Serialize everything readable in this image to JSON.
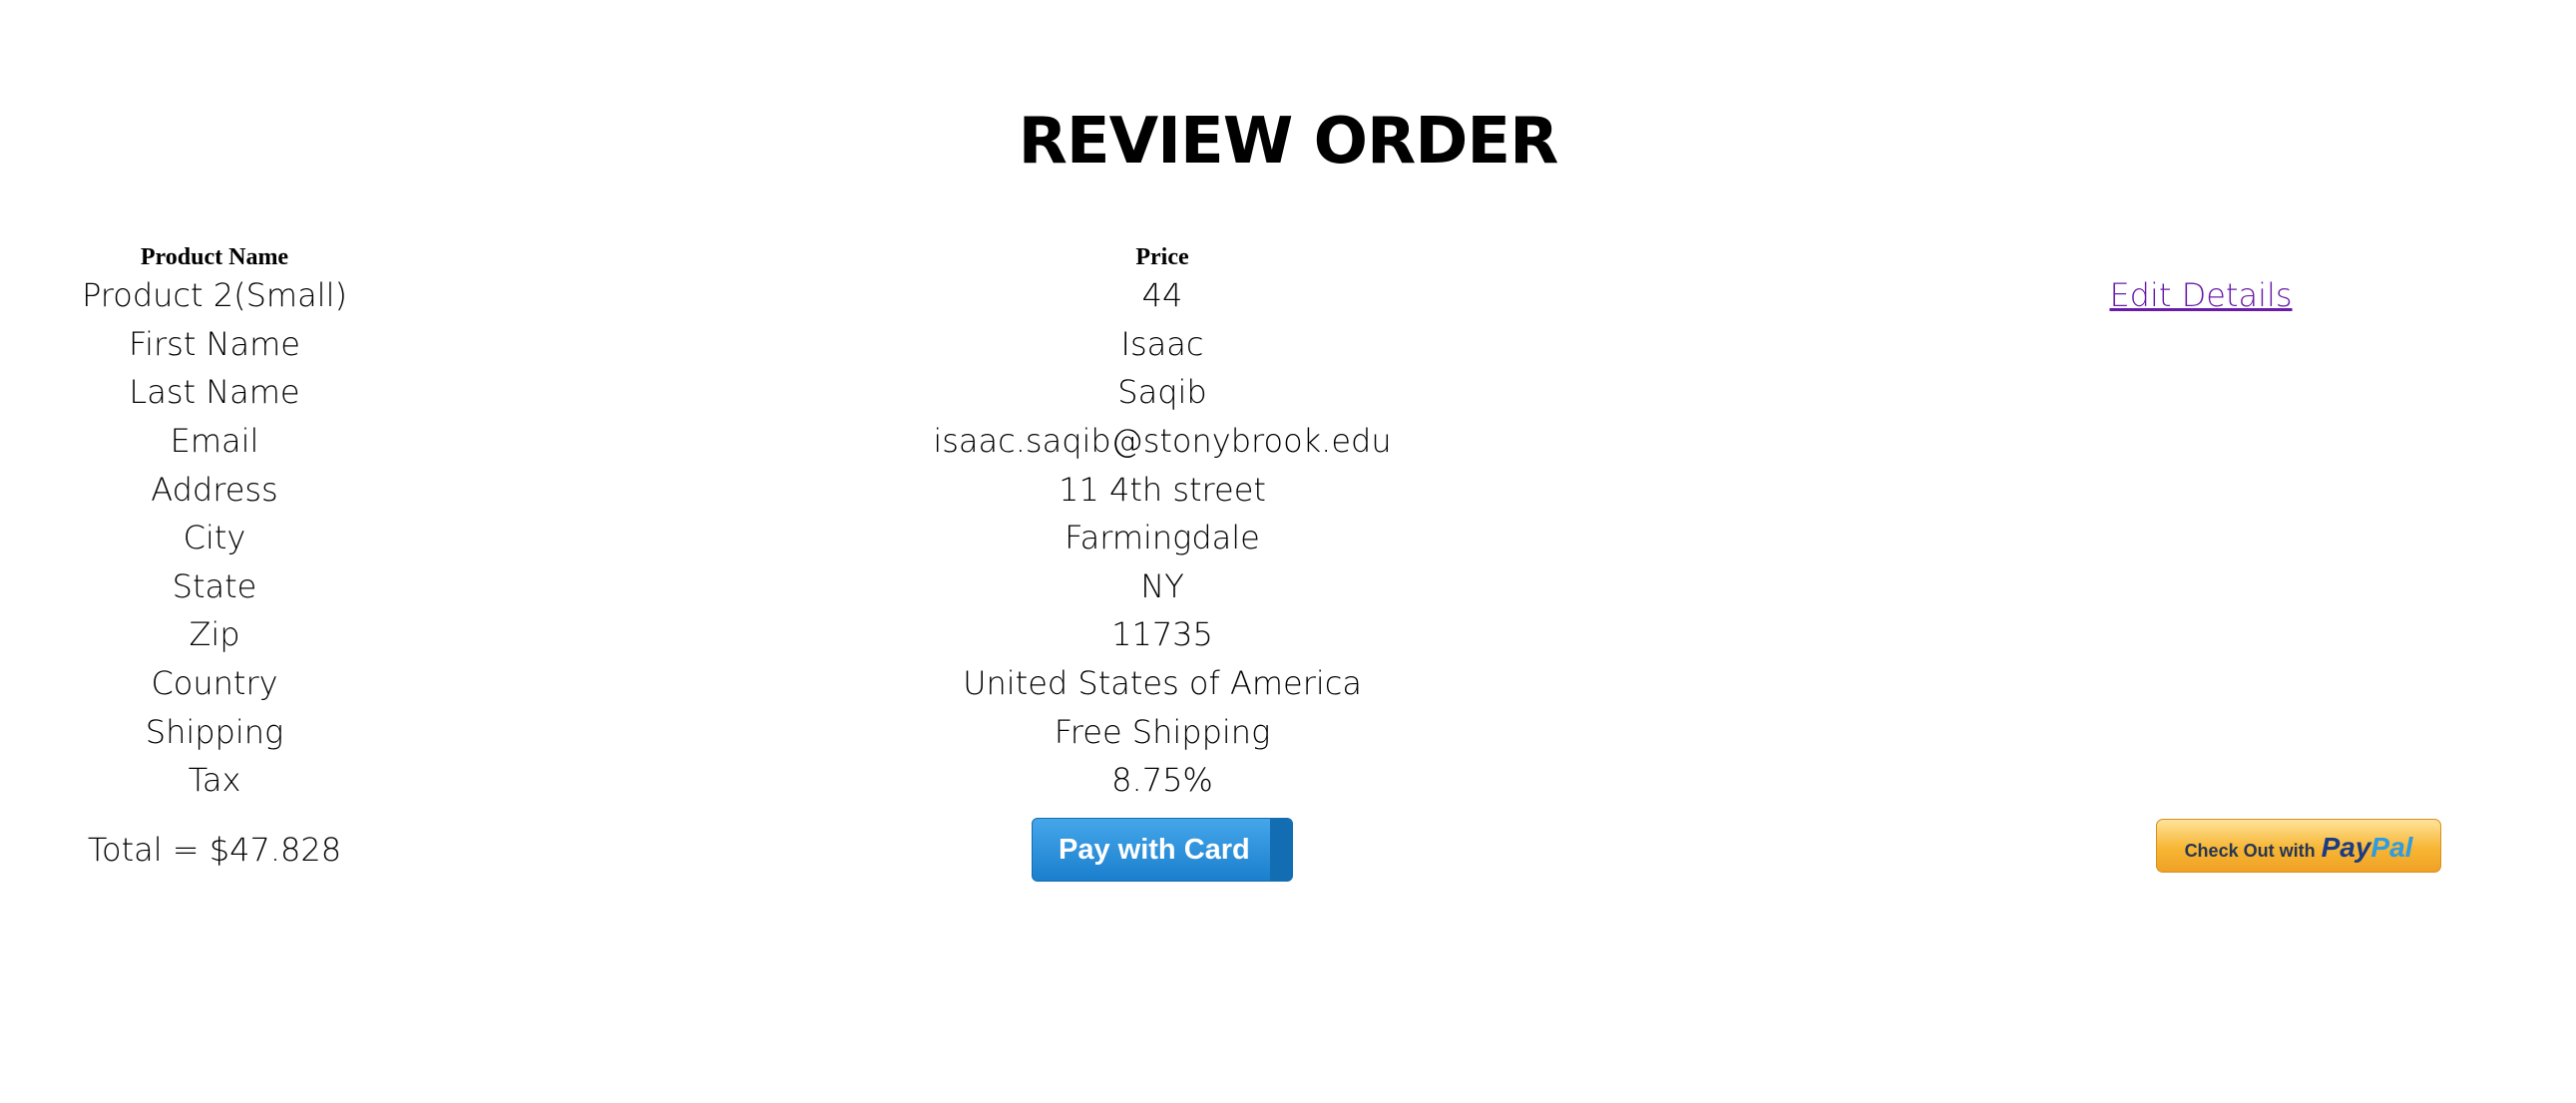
{
  "page": {
    "title": "REVIEW ORDER"
  },
  "table": {
    "headers": {
      "product_name": "Product Name",
      "price": "Price"
    },
    "rows": [
      {
        "label": "Product 2(Small)",
        "value": "44"
      },
      {
        "label": "First Name",
        "value": "Isaac"
      },
      {
        "label": "Last Name",
        "value": "Saqib"
      },
      {
        "label": "Email",
        "value": "isaac.saqib@stonybrook.edu"
      },
      {
        "label": "Address",
        "value": "11 4th street"
      },
      {
        "label": "City",
        "value": "Farmingdale"
      },
      {
        "label": "State",
        "value": "NY"
      },
      {
        "label": "Zip",
        "value": "11735"
      },
      {
        "label": "Country",
        "value": "United States of America"
      },
      {
        "label": "Shipping",
        "value": "Free Shipping"
      },
      {
        "label": "Tax",
        "value": "8.75%"
      }
    ],
    "edit_link": "Edit Details"
  },
  "footer": {
    "total": "Total = $47.828",
    "pay_card_label": "Pay with Card",
    "paypal_checkout_text": "Check Out with",
    "paypal_logo_pay": "Pay",
    "paypal_logo_pal": "Pal"
  },
  "colors": {
    "link": "#681da8",
    "pay_card_button": "#1a7fcd",
    "paypal_button": "#f7b633"
  }
}
